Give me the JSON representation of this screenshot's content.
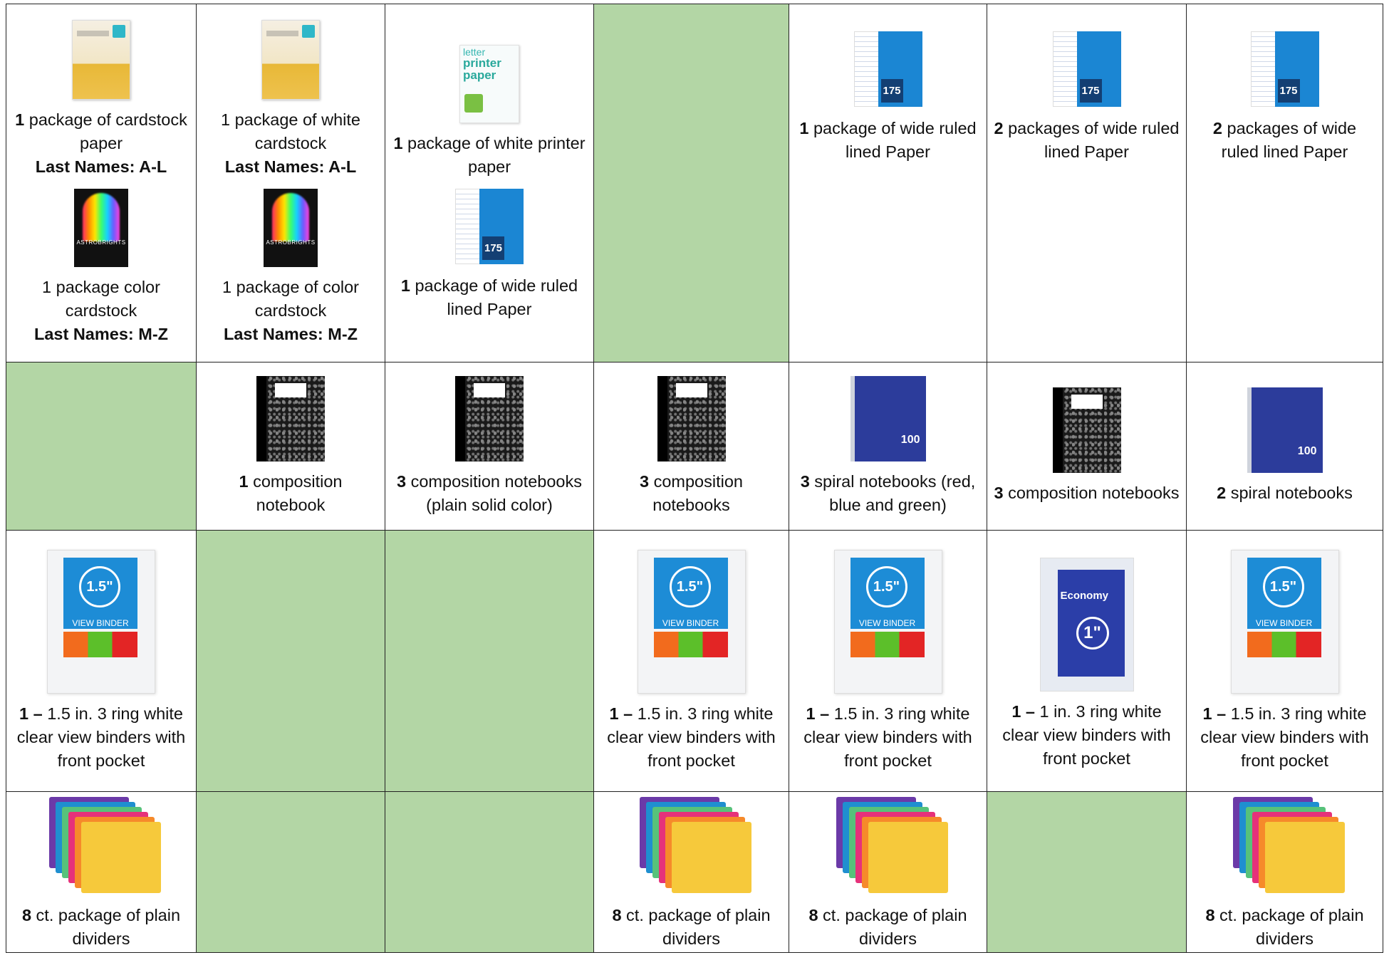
{
  "colors": {
    "filled_cell": "#b3d6a5",
    "grid_line": "#222222"
  },
  "rows": [
    {
      "cells": [
        {
          "filled": false,
          "items": [
            {
              "image": "cardstock-package-icon",
              "qty": "1",
              "text": " package of cardstock paper",
              "qty_bold": true,
              "sub": "Last Names: A-L"
            },
            {
              "image": "astrobrights-cardstock-icon",
              "qty": "",
              "text": "1 package color cardstock",
              "qty_bold": false,
              "sub": "Last Names: M-Z"
            }
          ]
        },
        {
          "filled": false,
          "items": [
            {
              "image": "cardstock-package-icon",
              "qty": "",
              "text": "1 package of white cardstock",
              "qty_bold": false,
              "sub": "Last Names: A-L"
            },
            {
              "image": "astrobrights-cardstock-icon",
              "qty": "",
              "text": "1 package of color cardstock",
              "qty_bold": false,
              "sub": "Last Names: M-Z"
            }
          ]
        },
        {
          "filled": false,
          "items": [
            {
              "image": "printer-paper-icon",
              "qty": "1",
              "text": " package of white printer paper",
              "qty_bold": true,
              "sub": ""
            },
            {
              "image": "filler-paper-icon",
              "qty": "1",
              "text": " package of wide ruled lined Paper",
              "qty_bold": true,
              "sub": ""
            }
          ]
        },
        {
          "filled": true,
          "items": []
        },
        {
          "filled": false,
          "valign": "top",
          "items": [
            {
              "image": "filler-paper-icon",
              "qty": "1",
              "text": " package of wide ruled lined Paper",
              "qty_bold": true,
              "sub": ""
            }
          ]
        },
        {
          "filled": false,
          "valign": "top",
          "items": [
            {
              "image": "filler-paper-icon",
              "qty": "2",
              "text": " packages of wide ruled lined Paper",
              "qty_bold": true,
              "sub": ""
            }
          ]
        },
        {
          "filled": false,
          "valign": "top",
          "items": [
            {
              "image": "filler-paper-icon",
              "qty": "2",
              "text": " packages of wide ruled lined Paper",
              "qty_bold": true,
              "sub": ""
            }
          ]
        }
      ]
    },
    {
      "cells": [
        {
          "filled": true,
          "items": []
        },
        {
          "filled": false,
          "items": [
            {
              "image": "composition-notebook-icon",
              "qty": "1",
              "text": " composition notebook",
              "qty_bold": true,
              "sub": ""
            }
          ]
        },
        {
          "filled": false,
          "items": [
            {
              "image": "composition-notebook-icon",
              "qty": "3",
              "text": " composition notebooks (plain solid color)",
              "qty_bold": true,
              "sub": ""
            }
          ]
        },
        {
          "filled": false,
          "items": [
            {
              "image": "composition-notebook-icon",
              "qty": "3",
              "text": " composition notebooks",
              "qty_bold": true,
              "sub": ""
            }
          ]
        },
        {
          "filled": false,
          "items": [
            {
              "image": "spiral-notebook-icon",
              "qty": "3",
              "text": " spiral notebooks (red, blue and green)",
              "qty_bold": true,
              "sub": ""
            }
          ]
        },
        {
          "filled": false,
          "items": [
            {
              "image": "composition-notebook-icon",
              "qty": "3",
              "text": " composition notebooks",
              "qty_bold": true,
              "sub": ""
            }
          ]
        },
        {
          "filled": false,
          "items": [
            {
              "image": "spiral-notebook-icon",
              "qty": "2",
              "text": " spiral notebooks",
              "qty_bold": true,
              "sub": ""
            }
          ]
        }
      ]
    },
    {
      "cells": [
        {
          "filled": false,
          "items": [
            {
              "image": "view-binder-icon",
              "qty": "1 –",
              "text": " 1.5 in. 3 ring white clear view binders with front pocket",
              "qty_bold": true,
              "sub": ""
            }
          ]
        },
        {
          "filled": true,
          "items": []
        },
        {
          "filled": true,
          "items": []
        },
        {
          "filled": false,
          "items": [
            {
              "image": "view-binder-icon",
              "qty": "1 –",
              "text": " 1.5 in. 3 ring white clear view binders with front pocket",
              "qty_bold": true,
              "sub": ""
            }
          ]
        },
        {
          "filled": false,
          "items": [
            {
              "image": "view-binder-icon",
              "qty": "1 –",
              "text": " 1.5 in. 3 ring white clear view binders with front pocket",
              "qty_bold": true,
              "sub": ""
            }
          ]
        },
        {
          "filled": false,
          "valign": "top",
          "items": [
            {
              "image": "avery-binder-icon",
              "qty": "1 –",
              "text": " 1 in. 3 ring white clear view binders with front pocket",
              "qty_bold": true,
              "sub": ""
            }
          ]
        },
        {
          "filled": false,
          "items": [
            {
              "image": "view-binder-icon",
              "qty": "1 –",
              "text": " 1.5 in. 3 ring white clear view binders with front pocket",
              "qty_bold": true,
              "sub": ""
            }
          ]
        }
      ]
    },
    {
      "cells": [
        {
          "filled": false,
          "items": [
            {
              "image": "dividers-icon",
              "qty": "8",
              "text": " ct. package of plain dividers",
              "qty_bold": true,
              "sub": ""
            }
          ]
        },
        {
          "filled": true,
          "items": []
        },
        {
          "filled": true,
          "items": []
        },
        {
          "filled": false,
          "items": [
            {
              "image": "dividers-icon",
              "qty": "8",
              "text": " ct. package of plain dividers",
              "qty_bold": true,
              "sub": ""
            }
          ]
        },
        {
          "filled": false,
          "items": [
            {
              "image": "dividers-icon",
              "qty": "8",
              "text": " ct. package of plain dividers",
              "qty_bold": true,
              "sub": ""
            }
          ]
        },
        {
          "filled": true,
          "items": []
        },
        {
          "filled": false,
          "items": [
            {
              "image": "dividers-icon",
              "qty": "8",
              "text": " ct. package of plain dividers",
              "qty_bold": true,
              "sub": ""
            }
          ]
        }
      ]
    }
  ],
  "image_labels": {
    "printer_top": "letter",
    "printer_main": "printer paper",
    "binder_ring": "1.5\"",
    "binder_caption": "VIEW BINDER",
    "avery_ring": "1\"",
    "avery_brand": "Economy"
  }
}
